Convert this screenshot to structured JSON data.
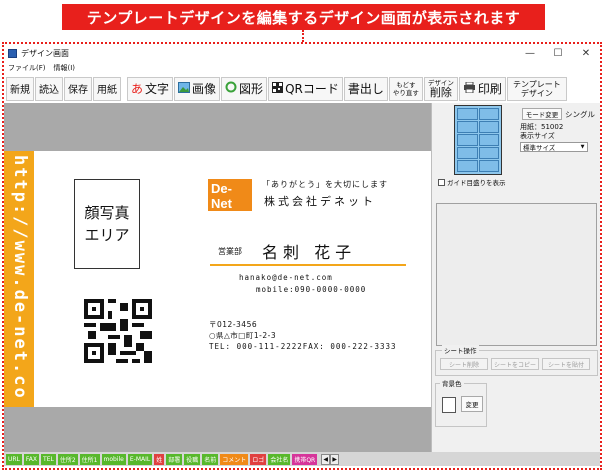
{
  "banner": "テンプレートデザインを編集するデザイン画面が表示されます",
  "window": {
    "title": "デザイン画面",
    "minimize": "—",
    "maximize": "☐",
    "close": "✕"
  },
  "menu": [
    "ファイル(F)",
    "情報(I)"
  ],
  "toolbar": {
    "new": "新規",
    "open": "読込",
    "save": "保存",
    "paper": "用紙",
    "text_icon": "あ",
    "text": "文字",
    "image": "画像",
    "shape": "図形",
    "qr": "QRコード",
    "export": "書出し",
    "undo_top": "もどす",
    "undo_bottom": "やり直す",
    "delete_top": "デザイン",
    "delete_bottom": "削除",
    "print": "印刷",
    "template_top": "テンプレート",
    "template_bottom": "デザイン"
  },
  "card": {
    "side_url": "http://www.de-net.co",
    "photo_placeholder_1": "顔写真",
    "photo_placeholder_2": "エリア",
    "logo_text_top": "De-",
    "logo_text_bottom": "Net",
    "tagline": "「ありがとう」を大切にします",
    "company": "株式会社デネット",
    "department": "営業部",
    "name": "名刺 花子",
    "email": "hanako@de-net.com",
    "mobile": "mobile:090-0000-0000",
    "postal": "〒012-3456",
    "address": "○県△市□町1-2-3",
    "tel_fax": "TEL: 000-111-2222FAX: 000-222-3333"
  },
  "panel": {
    "mode_button": "モード変更",
    "mode_value": "シングル",
    "paper_label": "用紙：51002",
    "size_label": "表示サイズ",
    "size_value": "標準サイズ",
    "guide_label": "ガイド目盛りを表示",
    "sheet_ops_legend": "シート操作",
    "sheet_delete": "シート削除",
    "sheet_copy": "シートをコピー",
    "sheet_paste": "シートを貼付",
    "bg_legend": "背景色",
    "bg_change": "変更"
  },
  "fields": [
    {
      "label": "URL",
      "color": "g"
    },
    {
      "label": "FAX",
      "color": "g"
    },
    {
      "label": "TEL",
      "color": "g"
    },
    {
      "label": "住所2",
      "color": "g"
    },
    {
      "label": "住所1",
      "color": "g"
    },
    {
      "label": "mobile",
      "color": "g"
    },
    {
      "label": "E-MAIL",
      "color": "g"
    },
    {
      "label": "姓",
      "color": "r"
    },
    {
      "label": "部署",
      "color": "g"
    },
    {
      "label": "役職",
      "color": "g"
    },
    {
      "label": "名前",
      "color": "g"
    },
    {
      "label": "コメント",
      "color": "o"
    },
    {
      "label": "ロゴ",
      "color": "r"
    },
    {
      "label": "会社名",
      "color": "g"
    },
    {
      "label": "携帯QR",
      "color": "m"
    }
  ],
  "colors": {
    "accent_red": "#e8201c",
    "card_orange": "#f3a61a"
  }
}
